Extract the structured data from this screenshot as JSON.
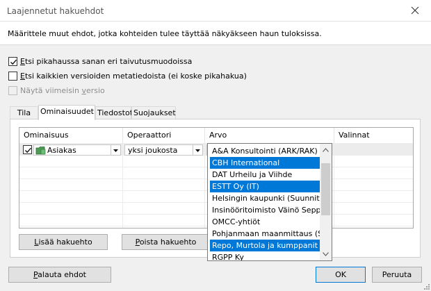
{
  "window": {
    "title": "Laajennetut hakuehdot"
  },
  "description": "Määrittele muut ehdot, jotka kohteiden tulee täyttää näkyäkseen haun tuloksissa.",
  "options": [
    {
      "underline": "E",
      "rest": "tsi pikahaussa sanan eri taivutusmuodoissa",
      "checked": true,
      "enabled": true
    },
    {
      "underline": "E",
      "rest": "tsi kaikkien versioiden metatiedoista (ei koske pikahakua)",
      "checked": false,
      "enabled": true
    },
    {
      "before": "Näytä viimeisin ",
      "underline": "v",
      "rest": "ersio",
      "checked": false,
      "enabled": false
    }
  ],
  "tabs": [
    "Tila",
    "Ominaisuudet",
    "Tiedostot",
    "Suojaukset"
  ],
  "active_tab": "Ominaisuudet",
  "grid": {
    "columns": [
      "Ominaisuus",
      "Operaattori",
      "Arvo",
      "Valinnat"
    ],
    "row": {
      "property": "Asiakas",
      "operator": "yksi joukosta",
      "value": "",
      "checked": true
    }
  },
  "value_list": {
    "items": [
      {
        "label": "A&A Konsultointi (ARK/RAK)",
        "selected": false
      },
      {
        "label": "CBH International",
        "selected": true
      },
      {
        "label": "DAT Urheilu ja Viihde",
        "selected": false
      },
      {
        "label": "ESTT Oy (IT)",
        "selected": true
      },
      {
        "label": "Helsingin kaupunki (Suunnittel...",
        "selected": false
      },
      {
        "label": "Insinööritoimisto Väinö Seppä...",
        "selected": false
      },
      {
        "label": "OMCC-yhtiöt",
        "selected": false
      },
      {
        "label": "Pohjanmaan maanmittaus (Se...",
        "selected": false
      },
      {
        "label": "Repo, Murtola ja kumppanit",
        "selected": true
      },
      {
        "label": "RGPP Ky",
        "selected": false
      }
    ],
    "selection_color": "#0078d7"
  },
  "buttons": {
    "add": {
      "underline": "L",
      "rest": "isää hakuehto"
    },
    "remove": {
      "underline": "P",
      "rest": "oista hakuehto"
    },
    "reset": {
      "underline": "P",
      "rest": "alauta ehdot"
    },
    "ok": "OK",
    "cancel": "Peruuta"
  }
}
